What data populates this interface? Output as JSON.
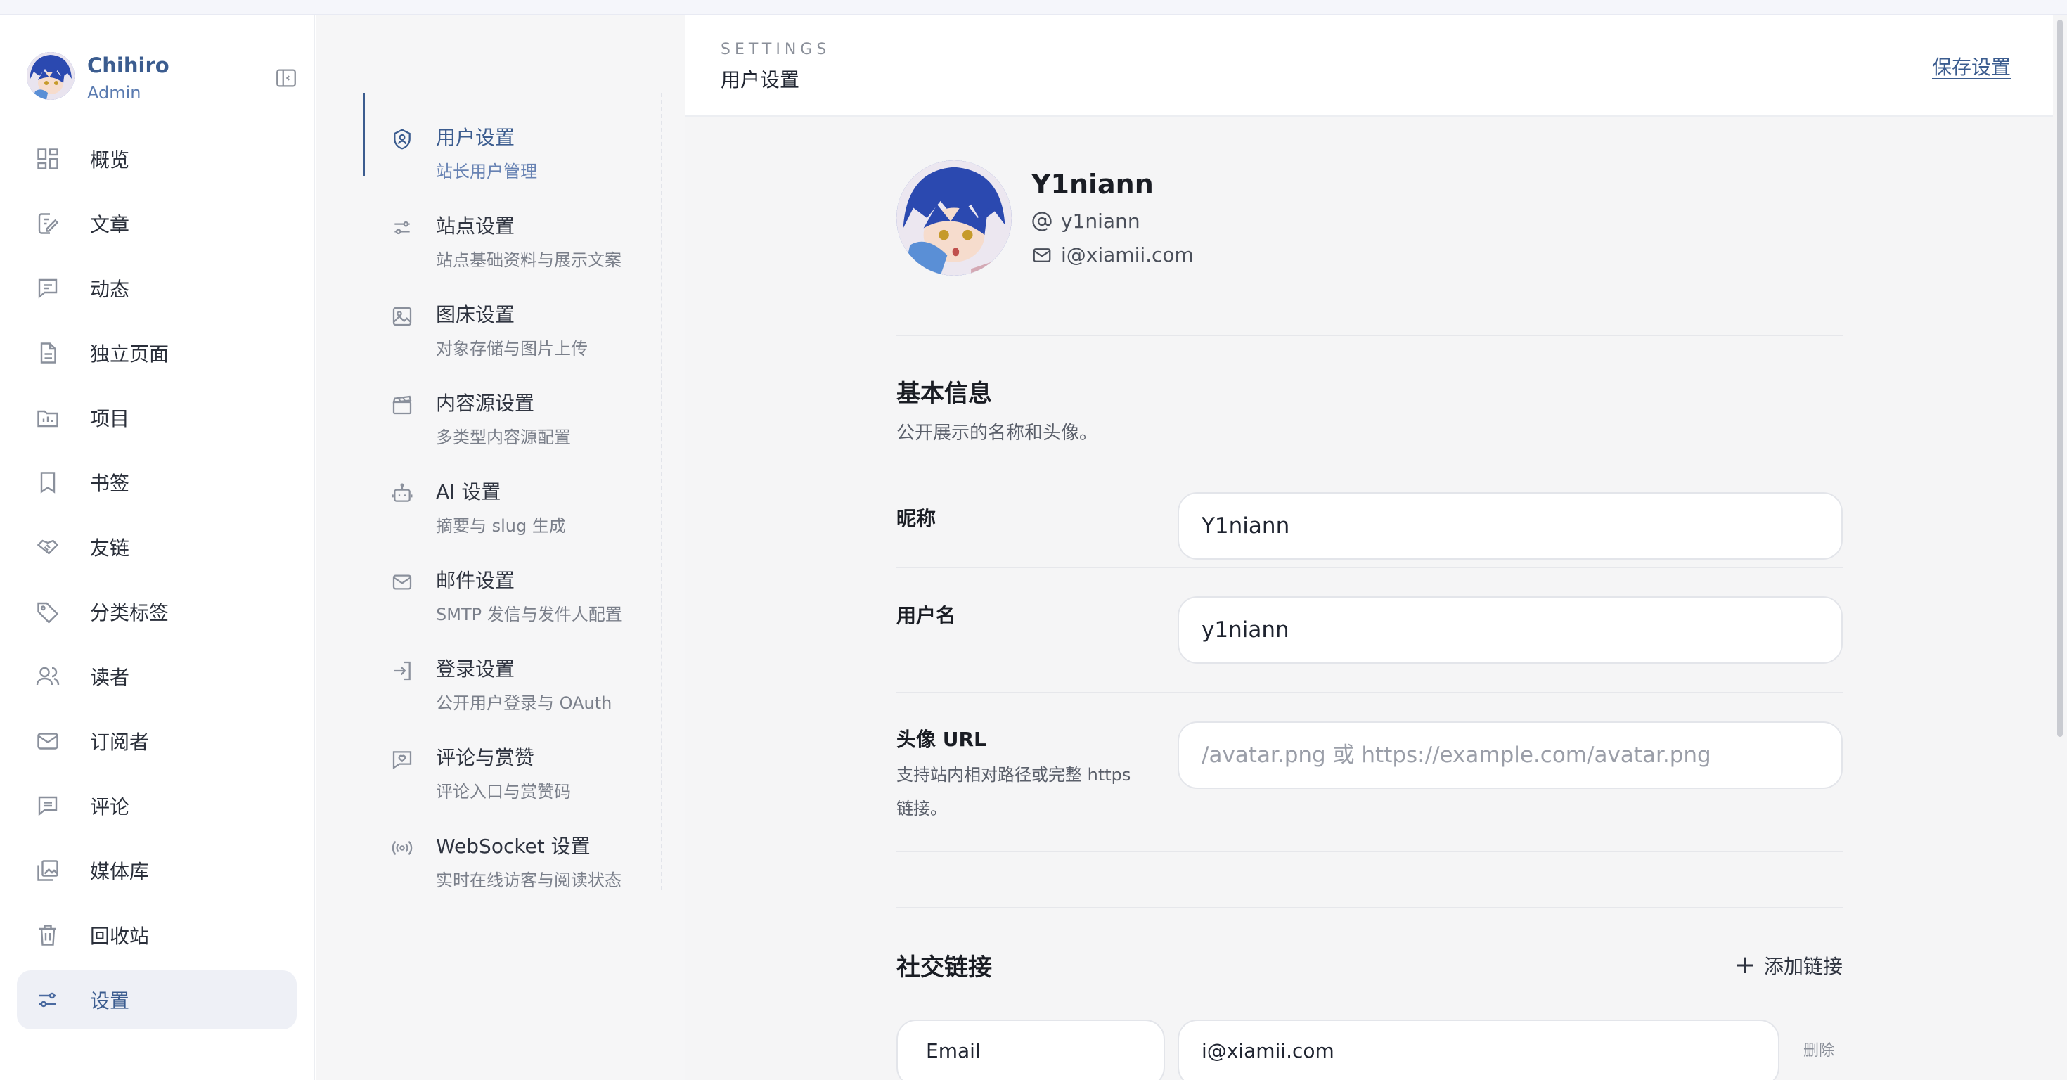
{
  "sidebar": {
    "user": {
      "name": "Chihiro",
      "role": "Admin"
    },
    "items": [
      {
        "label": "概览",
        "icon": "grid-icon"
      },
      {
        "label": "文章",
        "icon": "edit-icon"
      },
      {
        "label": "动态",
        "icon": "message-icon"
      },
      {
        "label": "独立页面",
        "icon": "document-icon"
      },
      {
        "label": "项目",
        "icon": "folder-icon"
      },
      {
        "label": "书签",
        "icon": "bookmark-icon"
      },
      {
        "label": "友链",
        "icon": "handshake-icon"
      },
      {
        "label": "分类标签",
        "icon": "tag-icon"
      },
      {
        "label": "读者",
        "icon": "users-icon"
      },
      {
        "label": "订阅者",
        "icon": "mail-icon"
      },
      {
        "label": "评论",
        "icon": "comment-icon"
      },
      {
        "label": "媒体库",
        "icon": "gallery-icon"
      },
      {
        "label": "回收站",
        "icon": "trash-icon"
      },
      {
        "label": "设置",
        "icon": "sliders-icon",
        "active": true
      }
    ]
  },
  "subnav": {
    "items": [
      {
        "title": "用户设置",
        "desc": "站长用户管理",
        "icon": "user-shield-icon",
        "active": true
      },
      {
        "title": "站点设置",
        "desc": "站点基础资料与展示文案",
        "icon": "sliders-icon"
      },
      {
        "title": "图床设置",
        "desc": "对象存储与图片上传",
        "icon": "image-icon"
      },
      {
        "title": "内容源设置",
        "desc": "多类型内容源配置",
        "icon": "clapperboard-icon"
      },
      {
        "title": "AI 设置",
        "desc": "摘要与 slug 生成",
        "icon": "bot-icon"
      },
      {
        "title": "邮件设置",
        "desc": "SMTP 发信与发件人配置",
        "icon": "mail-icon"
      },
      {
        "title": "登录设置",
        "desc": "公开用户登录与 OAuth",
        "icon": "login-icon"
      },
      {
        "title": "评论与赏赞",
        "desc": "评论入口与赏赞码",
        "icon": "heart-message-icon"
      },
      {
        "title": "WebSocket 设置",
        "desc": "实时在线访客与阅读状态",
        "icon": "broadcast-icon"
      }
    ]
  },
  "header": {
    "eyebrow": "SETTINGS",
    "title": "用户设置",
    "save_label": "保存设置"
  },
  "profile": {
    "name": "Y1niann",
    "handle": "y1niann",
    "email": "i@xiamii.com"
  },
  "basic": {
    "title": "基本信息",
    "desc": "公开展示的名称和头像。",
    "nickname_label": "昵称",
    "nickname_value": "Y1niann",
    "username_label": "用户名",
    "username_value": "y1niann",
    "avatar_label": "头像 URL",
    "avatar_hint": "支持站内相对路径或完整 https 链接。",
    "avatar_placeholder": "/avatar.png 或 https://example.com/avatar.png"
  },
  "social": {
    "title": "社交链接",
    "add_label": "添加链接",
    "rows": [
      {
        "type": "Email",
        "value": "i@xiamii.com",
        "delete_label": "删除"
      }
    ]
  },
  "colors": {
    "accent": "#3b5c8f",
    "bg_main": "#f5f5f6",
    "active_bg": "#eef0f6"
  }
}
